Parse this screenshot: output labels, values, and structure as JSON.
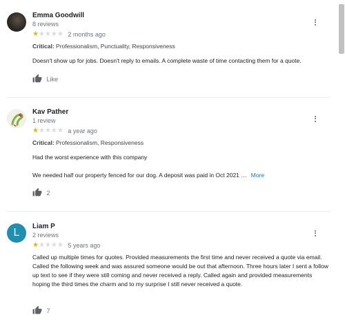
{
  "reviews": [
    {
      "name": "Emma Goodwill",
      "count": "8 reviews",
      "rating": 1,
      "time": "2 months ago",
      "critical_label": "Critical:",
      "critical_items": "Professionalism, Punctuality, Responsiveness",
      "paragraphs": [
        "Doesn't show up for jobs. Doesn't reply to emails. A complete waste of time contacting them for a quote."
      ],
      "more": "",
      "like_label": "Like"
    },
    {
      "name": "Kav Pather",
      "count": "1 review",
      "rating": 1,
      "time": "a year ago",
      "critical_label": "Critical:",
      "critical_items": "Professionalism, Responsiveness",
      "paragraphs": [
        "Had the worst experience with this company",
        "We needed half our property fenced for our dog. A deposit was paid in Oct 2021 …"
      ],
      "more": "More",
      "like_label": "2"
    },
    {
      "name": "Liam P",
      "avatar_letter": "L",
      "count": "2 reviews",
      "rating": 1,
      "time": "5 years ago",
      "paragraphs": [
        "Called up multiple times for quotes. Provided measurements the first time and never received a quote via email. Called the following week and was assured someone would be out that afternoon. Three hours later I sent a follow up text to see if they were still coming and never received a reply. Called again and provided measurements hoping the third times the charm and to my surprise I still never received a quote."
      ],
      "more": "",
      "like_label": "7"
    }
  ],
  "icons": {
    "star": "star-icon",
    "thumb": "thumbs-up-icon",
    "menu": "more-vert-icon"
  },
  "colors": {
    "star_on": "#f4b400",
    "star_off": "#dadce0",
    "link": "#1a73e8",
    "avatar_L": "#1e8fb0"
  }
}
